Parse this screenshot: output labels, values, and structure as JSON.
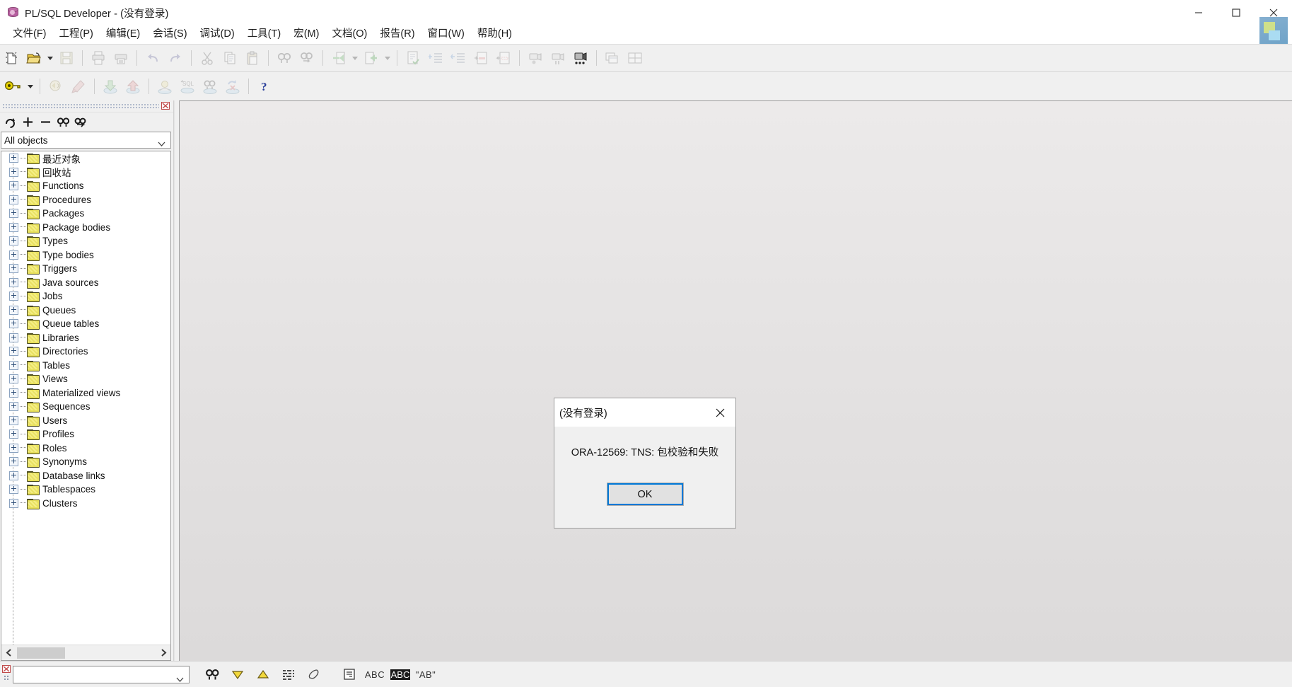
{
  "window": {
    "title": "PL/SQL Developer - (没有登录)",
    "app_icon": "database-icon",
    "controls": [
      {
        "name": "minimize-button",
        "glyph": "minimize-icon"
      },
      {
        "name": "maximize-button",
        "glyph": "maximize-icon"
      },
      {
        "name": "close-button",
        "glyph": "close-icon"
      }
    ]
  },
  "menubar": {
    "items": [
      {
        "label": "文件(F)",
        "name": "menu-file"
      },
      {
        "label": "工程(P)",
        "name": "menu-project"
      },
      {
        "label": "编辑(E)",
        "name": "menu-edit"
      },
      {
        "label": "会话(S)",
        "name": "menu-session"
      },
      {
        "label": "调试(D)",
        "name": "menu-debug"
      },
      {
        "label": "工具(T)",
        "name": "menu-tools"
      },
      {
        "label": "宏(M)",
        "name": "menu-macro"
      },
      {
        "label": "文档(O)",
        "name": "menu-document"
      },
      {
        "label": "报告(R)",
        "name": "menu-report"
      },
      {
        "label": "窗口(W)",
        "name": "menu-window"
      },
      {
        "label": "帮助(H)",
        "name": "menu-help"
      }
    ],
    "brand_logo": "plsql-brand-logo"
  },
  "toolbar_row1": {
    "buttons": [
      {
        "name": "new-icon",
        "label": "新建",
        "enabled": true
      },
      {
        "name": "open-icon",
        "label": "打开",
        "enabled": true
      },
      {
        "name": "open-dropdown-icon",
        "label": "打开最近",
        "enabled": true
      },
      {
        "name": "save-icon",
        "label": "保存",
        "enabled": false
      },
      {
        "name": "print-icon",
        "label": "打印",
        "enabled": false
      },
      {
        "name": "print-preview-icon",
        "label": "打印预览",
        "enabled": false
      },
      {
        "name": "undo-icon",
        "label": "撤销",
        "enabled": false
      },
      {
        "name": "redo-icon",
        "label": "重做",
        "enabled": false
      },
      {
        "name": "cut-icon",
        "label": "剪切",
        "enabled": false
      },
      {
        "name": "copy-icon",
        "label": "复制",
        "enabled": false
      },
      {
        "name": "paste-icon",
        "label": "粘贴",
        "enabled": false
      },
      {
        "name": "find-icon",
        "label": "查找",
        "enabled": false
      },
      {
        "name": "find-next-icon",
        "label": "查找下一个",
        "enabled": false
      },
      {
        "name": "previous-icon",
        "label": "上一个",
        "enabled": false
      },
      {
        "name": "previous-dropdown-icon",
        "label": "上一个列表",
        "enabled": false
      },
      {
        "name": "next-icon",
        "label": "下一个",
        "enabled": false
      },
      {
        "name": "next-dropdown-icon",
        "label": "下一个列表",
        "enabled": false
      },
      {
        "name": "check-syntax-icon",
        "label": "语法检查",
        "enabled": false
      },
      {
        "name": "indent-icon",
        "label": "增加缩进",
        "enabled": false
      },
      {
        "name": "outdent-icon",
        "label": "减少缩进",
        "enabled": false
      },
      {
        "name": "comment-icon",
        "label": "注释",
        "enabled": false
      },
      {
        "name": "uncomment-icon",
        "label": "取消注释",
        "enabled": false
      },
      {
        "name": "record-macro-icon",
        "label": "录制宏",
        "enabled": false
      },
      {
        "name": "pause-macro-icon",
        "label": "暂停宏",
        "enabled": false
      },
      {
        "name": "play-macro-icon",
        "label": "播放宏",
        "enabled": true
      },
      {
        "name": "cascade-windows-icon",
        "label": "层叠窗口",
        "enabled": false
      },
      {
        "name": "tile-windows-icon",
        "label": "平铺窗口",
        "enabled": false
      }
    ]
  },
  "toolbar_row2": {
    "buttons": [
      {
        "name": "logon-key-icon",
        "label": "登录",
        "enabled": true
      },
      {
        "name": "logon-dropdown-icon",
        "label": "登录列表",
        "enabled": true
      },
      {
        "name": "execute-icon",
        "label": "执行",
        "enabled": false
      },
      {
        "name": "break-icon",
        "label": "中断",
        "enabled": false
      },
      {
        "name": "commit-icon",
        "label": "提交",
        "enabled": false
      },
      {
        "name": "rollback-icon",
        "label": "回滚",
        "enabled": false
      },
      {
        "name": "session-icon",
        "label": "会话",
        "enabled": false
      },
      {
        "name": "explain-plan-icon",
        "label": "解释计划",
        "enabled": false
      },
      {
        "name": "find-db-objects-icon",
        "label": "查找数据库对象",
        "enabled": false
      },
      {
        "name": "recompile-icon",
        "label": "重新编译",
        "enabled": false
      },
      {
        "name": "help-icon",
        "label": "帮助",
        "enabled": true
      }
    ]
  },
  "browser": {
    "panel_name": "object-browser",
    "close_icon": "panel-close-icon",
    "toolbar": [
      {
        "name": "refresh-icon",
        "label": "刷新"
      },
      {
        "name": "add-icon",
        "label": "添加"
      },
      {
        "name": "remove-icon",
        "label": "移除"
      },
      {
        "name": "find-icon",
        "label": "查找"
      },
      {
        "name": "filter-icon",
        "label": "过滤"
      }
    ],
    "filter_combo": {
      "value": "All objects",
      "placeholder": "All objects"
    },
    "tree": [
      {
        "label": "最近对象",
        "icon": "folder-icon",
        "expandable": true
      },
      {
        "label": "回收站",
        "icon": "folder-icon",
        "expandable": true
      },
      {
        "label": "Functions",
        "icon": "folder-icon",
        "expandable": true
      },
      {
        "label": "Procedures",
        "icon": "folder-icon",
        "expandable": true
      },
      {
        "label": "Packages",
        "icon": "folder-icon",
        "expandable": true
      },
      {
        "label": "Package bodies",
        "icon": "folder-icon",
        "expandable": true
      },
      {
        "label": "Types",
        "icon": "folder-icon",
        "expandable": true
      },
      {
        "label": "Type bodies",
        "icon": "folder-icon",
        "expandable": true
      },
      {
        "label": "Triggers",
        "icon": "folder-icon",
        "expandable": true
      },
      {
        "label": "Java sources",
        "icon": "folder-icon",
        "expandable": true
      },
      {
        "label": "Jobs",
        "icon": "folder-icon",
        "expandable": true
      },
      {
        "label": "Queues",
        "icon": "folder-icon",
        "expandable": true
      },
      {
        "label": "Queue tables",
        "icon": "folder-icon",
        "expandable": true
      },
      {
        "label": "Libraries",
        "icon": "folder-icon",
        "expandable": true
      },
      {
        "label": "Directories",
        "icon": "folder-icon",
        "expandable": true
      },
      {
        "label": "Tables",
        "icon": "folder-icon",
        "expandable": true
      },
      {
        "label": "Views",
        "icon": "folder-icon",
        "expandable": true
      },
      {
        "label": "Materialized views",
        "icon": "folder-icon",
        "expandable": true
      },
      {
        "label": "Sequences",
        "icon": "folder-icon",
        "expandable": true
      },
      {
        "label": "Users",
        "icon": "folder-icon",
        "expandable": true
      },
      {
        "label": "Profiles",
        "icon": "folder-icon",
        "expandable": true
      },
      {
        "label": "Roles",
        "icon": "folder-icon",
        "expandable": true
      },
      {
        "label": "Synonyms",
        "icon": "folder-icon",
        "expandable": true
      },
      {
        "label": "Database links",
        "icon": "folder-icon",
        "expandable": true
      },
      {
        "label": "Tablespaces",
        "icon": "folder-icon",
        "expandable": true
      },
      {
        "label": "Clusters",
        "icon": "folder-icon",
        "expandable": true
      }
    ],
    "hscroll": {
      "left_arrow": "scroll-left-icon",
      "right_arrow": "scroll-right-icon"
    }
  },
  "dialog": {
    "title": "(没有登录)",
    "message": "ORA-12569: TNS: 包校验和失败",
    "ok_label": "OK",
    "close_icon": "close-icon",
    "focus_color": "#0078d7"
  },
  "statusbar": {
    "search_combo": {
      "value": "",
      "placeholder": ""
    },
    "buttons": [
      {
        "name": "find-icon",
        "label": "查找"
      },
      {
        "name": "find-down-icon",
        "label": "向下查找"
      },
      {
        "name": "find-up-icon",
        "label": "向上查找"
      },
      {
        "name": "highlight-all-icon",
        "label": "全部高亮"
      },
      {
        "name": "clear-highlight-icon",
        "label": "清除高亮"
      },
      {
        "name": "scope-icon",
        "label": "范围"
      }
    ],
    "options": [
      {
        "name": "whole-words-option",
        "label": "ABC"
      },
      {
        "name": "match-case-option",
        "label": "ABC"
      },
      {
        "name": "regex-option",
        "label": "\"AB\""
      }
    ]
  },
  "colors": {
    "accent": "#0078d7",
    "toolbar_bg": "#f0f0f0",
    "workspace_bg": "#e4e2e2",
    "folder": "#e8e05a"
  }
}
